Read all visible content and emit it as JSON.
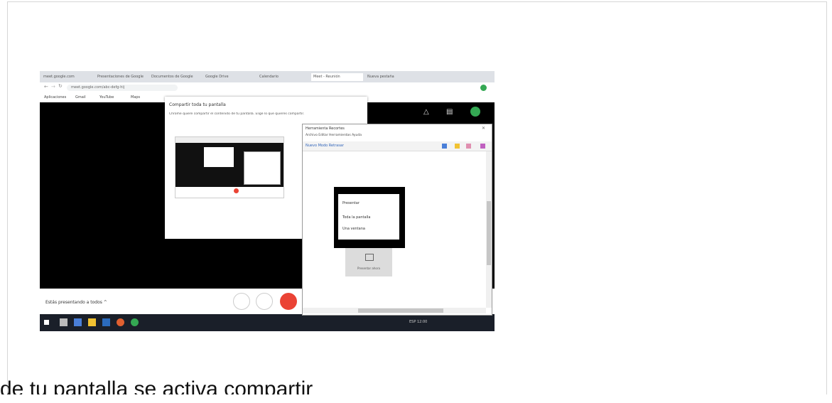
{
  "browser": {
    "tabs": [
      "meet.google.com",
      "Presentaciones de Google",
      "Documentos de Google",
      "Google Drive",
      "Calendario",
      "Meet - Reunión",
      "Nueva pestaña"
    ],
    "url": "meet.google.com/abc-defg-hij",
    "bookmarks": [
      "Aplicaciones",
      "Gmail",
      "YouTube",
      "Maps"
    ]
  },
  "share_dialog": {
    "title": "Compartir toda tu pantalla",
    "subtitle": "Chrome quiere compartir el contenido de tu pantalla. Elige lo que quieres compartir."
  },
  "snipping_tool": {
    "title": "Herramienta Recortes",
    "menu": "Archivo  Editar  Herramientas  Ayuda",
    "toolbar": "Nuevo  Modo  Retrasar",
    "menu_header": "Presentar",
    "option_1": "Toda la pantalla",
    "option_2": "Una ventana",
    "grey_label": "Presentar ahora"
  },
  "meet": {
    "present_label": "Estás presentando a todos  ^"
  },
  "taskbar": {
    "tray": "ESP  12:00"
  },
  "caption": "de tu pantalla se activa compartir",
  "colors": {
    "end_call": "#ea4335",
    "taskbar": "#1a1f29",
    "meet_green": "#34a853"
  }
}
